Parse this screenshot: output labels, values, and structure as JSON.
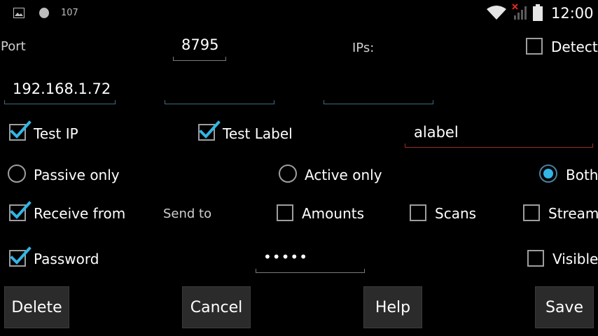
{
  "status_bar": {
    "notification_count": "107",
    "time": "12:00"
  },
  "port": {
    "label": "Port",
    "value": "8795"
  },
  "ips": {
    "label": "IPs:",
    "values": [
      "192.168.1.72",
      "",
      ""
    ]
  },
  "detect": {
    "label": "Detect",
    "checked": false
  },
  "test_ip": {
    "label": "Test IP",
    "checked": true
  },
  "test_label": {
    "label": "Test Label",
    "checked": true,
    "value": "alabel"
  },
  "mode": {
    "options": [
      "Passive only",
      "Active only",
      "Both"
    ],
    "selected": "Both"
  },
  "receive_from": {
    "label": "Receive from",
    "checked": true
  },
  "send_to": {
    "label": "Send to",
    "amounts": {
      "label": "Amounts",
      "checked": false
    },
    "scans": {
      "label": "Scans",
      "checked": false
    },
    "stream": {
      "label": "Stream",
      "checked": false
    }
  },
  "password": {
    "label": "Password",
    "checked": true,
    "value": "•••••"
  },
  "visible": {
    "label": "Visible",
    "checked": false
  },
  "buttons": {
    "delete": "Delete",
    "cancel": "Cancel",
    "help": "Help",
    "save": "Save"
  },
  "colors": {
    "accent": "#33b5e5",
    "field_line": "#3b6c80",
    "error_line": "#9a2d22",
    "button_bg": "#2b2b2b"
  }
}
